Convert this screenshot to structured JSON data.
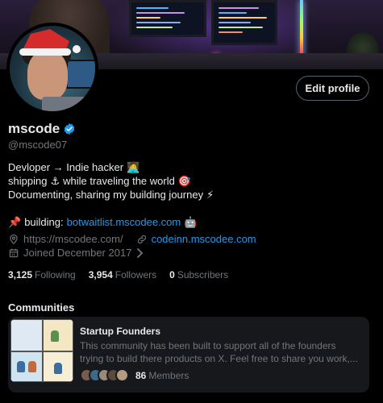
{
  "profile": {
    "display_name": "mscode",
    "handle": "@mscode07",
    "edit_button_label": "Edit profile",
    "verified": true
  },
  "bio": {
    "line1": "Devloper → Indie hacker",
    "line1_emoji": "🧑‍💻",
    "line2a": "shipping",
    "line2_emoji_a": "⚓",
    "line2b": "while traveling the world",
    "line2_emoji_b": "🎯",
    "line3": "Documenting, sharing my building journey",
    "line3_emoji": "⚡",
    "line5_emoji": "📌",
    "line5_prefix": "building:",
    "line5_link": "botwaitlist.mscodee.com",
    "line5_emoji_end": "🤖"
  },
  "meta": {
    "website_1": "https://mscodee.com/",
    "website_2": "codeinn.mscodee.com",
    "joined": "Joined December 2017"
  },
  "stats": {
    "following_count": "3,125",
    "following_label": "Following",
    "followers_count": "3,954",
    "followers_label": "Followers",
    "subscribers_count": "0",
    "subscribers_label": "Subscribers"
  },
  "communities": {
    "heading": "Communities",
    "items": [
      {
        "title": "Startup Founders",
        "description_line1": "This community has been built to support all of the founders",
        "description_line2": "trying to build there products on X. Feel free to share you work,...",
        "member_count": "86",
        "member_label": "Members"
      }
    ]
  },
  "colors": {
    "background": "#000000",
    "accent_link": "#1d9bf0",
    "verified_badge": "#1d9bf0",
    "muted_text": "#71767b",
    "card_background": "#16181c"
  },
  "icons": {
    "verified": "verified-badge-icon",
    "location": "location-pin-icon",
    "link": "link-icon",
    "calendar": "calendar-icon",
    "chevron": "chevron-right-icon"
  }
}
